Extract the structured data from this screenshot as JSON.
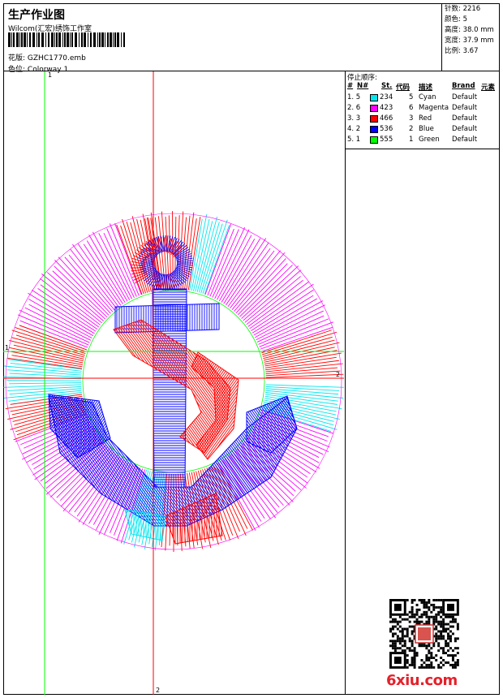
{
  "header": {
    "title": "生产作业图",
    "company": "Wilcom(汇宏)绣饰工作室",
    "file_label": "花版:",
    "file_name": "GZHC1770.emb",
    "colorway_label": "色位:",
    "colorway_name": "Colorway 1"
  },
  "stats": {
    "stitches": "针数: 2216",
    "colors": "颜色: 5",
    "height": "高度: 38.0 mm",
    "width": "宽度: 37.9 mm",
    "ratio": "比例: 3.67"
  },
  "stop_sequence": {
    "title": "停止顺序:",
    "headers": [
      "#",
      "N#",
      "St.",
      "代码",
      "描述",
      "Brand",
      "元素"
    ],
    "rows": [
      {
        "idx": "1. 5",
        "st": "234",
        "code": "5",
        "desc": "Cyan",
        "brand": "Default",
        "color": "#00e5ee"
      },
      {
        "idx": "2. 6",
        "st": "423",
        "code": "6",
        "desc": "Magenta",
        "brand": "Default",
        "color": "#ff00ff"
      },
      {
        "idx": "3. 3",
        "st": "466",
        "code": "3",
        "desc": "Red",
        "brand": "Default",
        "color": "#ff0000"
      },
      {
        "idx": "4. 2",
        "st": "536",
        "code": "2",
        "desc": "Blue",
        "brand": "Default",
        "color": "#0000ff"
      },
      {
        "idx": "5. 1",
        "st": "555",
        "code": "1",
        "desc": "Green",
        "brand": "Default",
        "color": "#00ff00"
      }
    ]
  },
  "axis_labels": {
    "v_green": "1",
    "h_green": "1",
    "v_red": "2",
    "h_red": "2"
  },
  "watermark": "6xiu.com",
  "colors": {
    "cyan": "#00e5ee",
    "magenta": "#ff00ff",
    "red": "#ff0000",
    "blue": "#0000ff",
    "green": "#00ff00"
  }
}
